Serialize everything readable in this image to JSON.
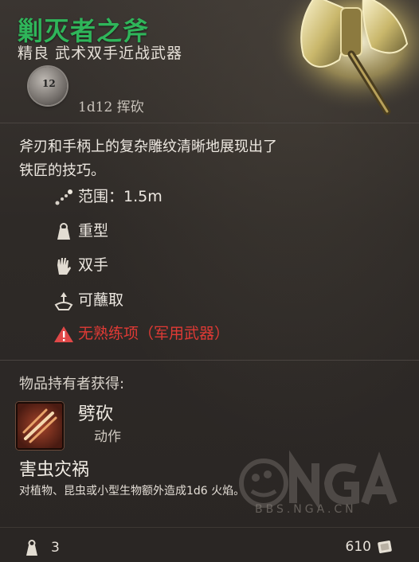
{
  "item": {
    "name": "剿灭者之斧",
    "rarity_and_type": "精良 武术双手近战武器",
    "die_label": "12",
    "damage": "1d12 挥砍",
    "description_line1": "斧刃和手柄上的复杂雕纹清晰地展现出了",
    "description_line2": "铁匠的技巧。"
  },
  "properties": [
    {
      "icon": "reach-icon",
      "label": "范围：1.5m"
    },
    {
      "icon": "heavy-weight-icon",
      "label": "重型"
    },
    {
      "icon": "two-hands-icon",
      "label": "双手"
    },
    {
      "icon": "dippable-icon",
      "label": "可蘸取"
    },
    {
      "icon": "warning-icon",
      "label": "无熟练项（军用武器）"
    }
  ],
  "granted": {
    "section_label": "物品持有者获得:",
    "skill_name": "劈砍",
    "skill_type": "动作",
    "skill_icon": "cleave-icon",
    "enchant_title": "害虫灾祸",
    "enchant_desc": "对植物、昆虫或小型生物额外造成1d6 火焰。"
  },
  "footer": {
    "weight": "3",
    "value": "610"
  },
  "watermark": {
    "url": "BBS.NGA.CN"
  },
  "colors": {
    "title": "#2fb55a",
    "warning": "#e03a35",
    "text": "#ede8e1"
  }
}
